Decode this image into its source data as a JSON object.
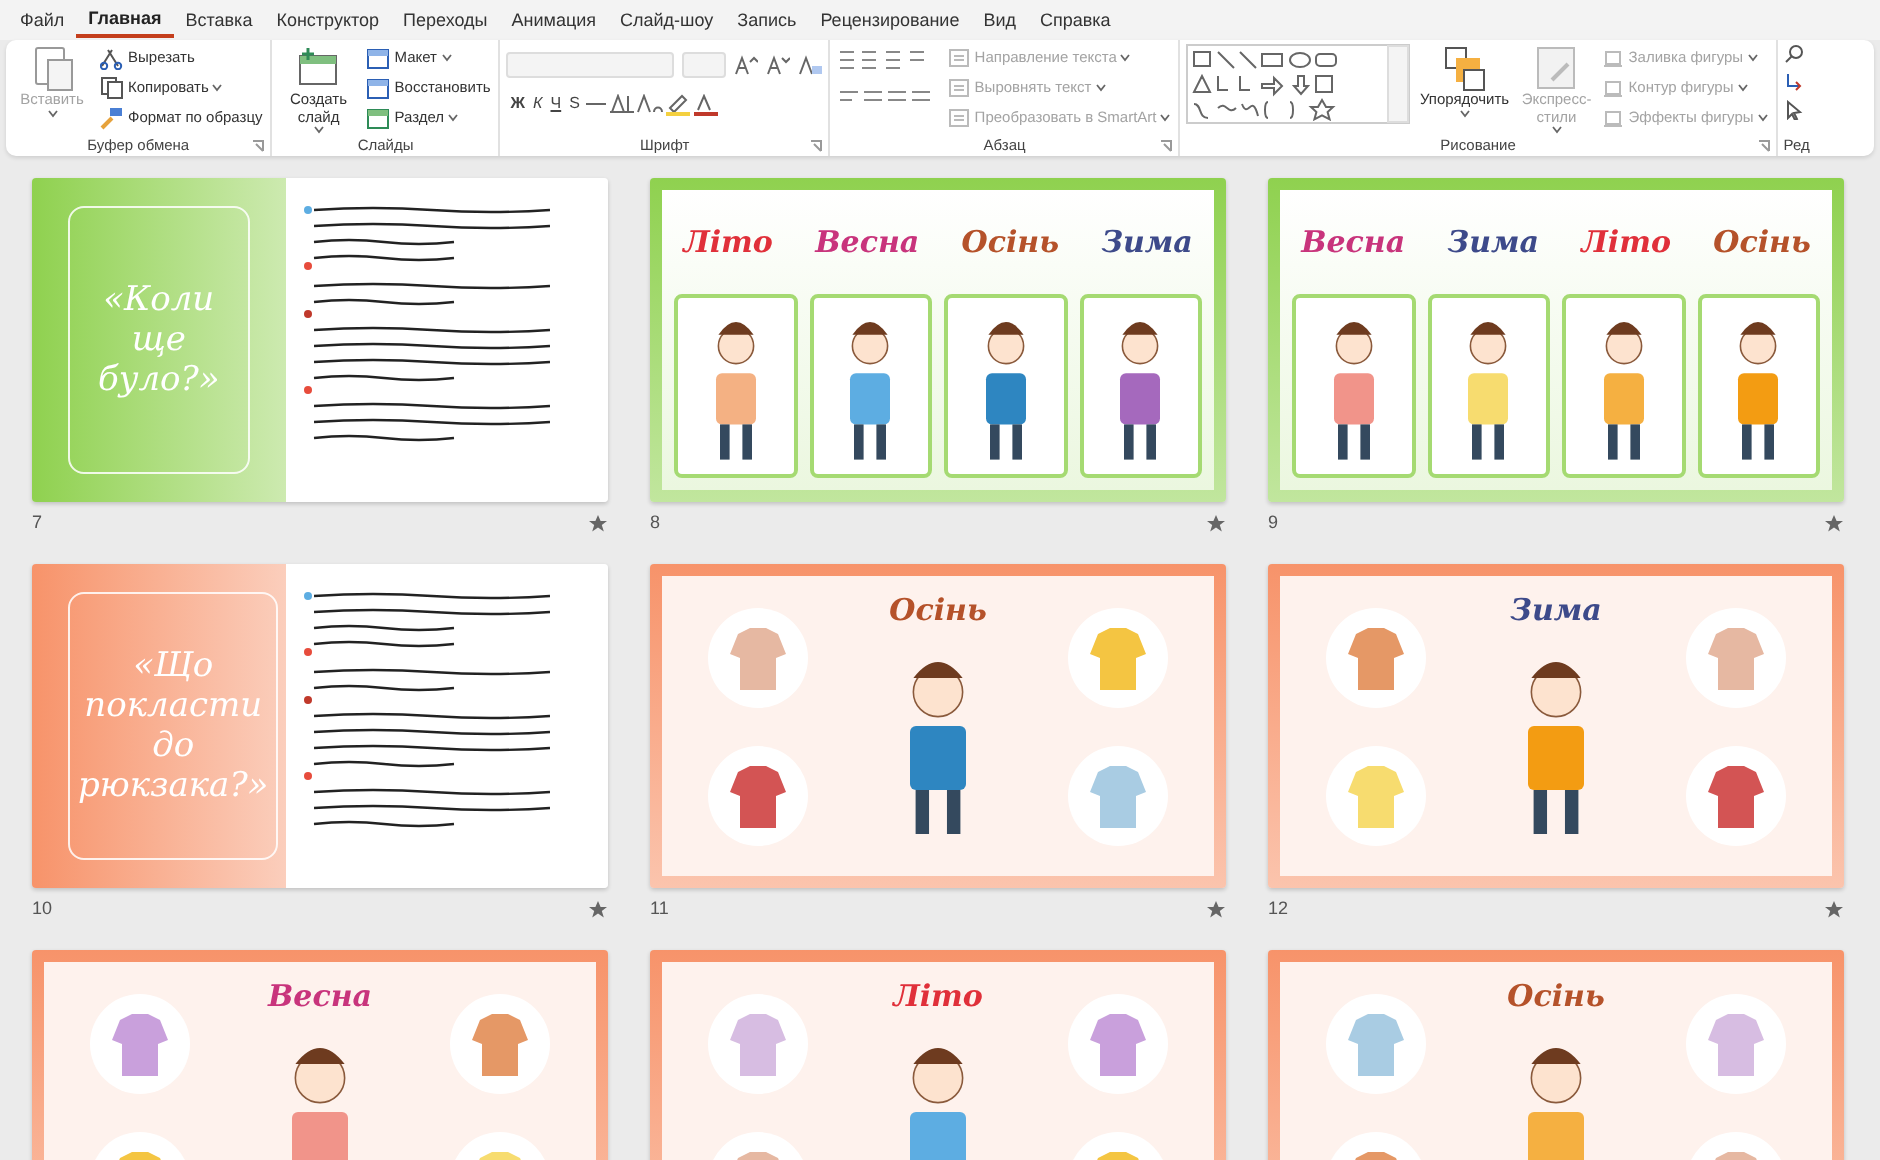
{
  "tabs": [
    {
      "label": "Файл",
      "selected": false
    },
    {
      "label": "Главная",
      "selected": true
    },
    {
      "label": "Вставка",
      "selected": false
    },
    {
      "label": "Конструктор",
      "selected": false
    },
    {
      "label": "Переходы",
      "selected": false
    },
    {
      "label": "Анимация",
      "selected": false
    },
    {
      "label": "Слайд-шоу",
      "selected": false
    },
    {
      "label": "Запись",
      "selected": false
    },
    {
      "label": "Рецензирование",
      "selected": false
    },
    {
      "label": "Вид",
      "selected": false
    },
    {
      "label": "Справка",
      "selected": false
    }
  ],
  "ribbon": {
    "groups": [
      {
        "kind": "commands",
        "label": "Буфер обмена",
        "launcher": true,
        "controls": [
          {
            "kind": "large",
            "label": "Вставить",
            "disabled": true,
            "dropdown": true
          },
          {
            "kind": "small",
            "label": "Вырезать",
            "disabled": false,
            "dropdown": false
          },
          {
            "kind": "small",
            "label": "Копировать",
            "disabled": false,
            "dropdown": true
          },
          {
            "kind": "small",
            "label": "Формат по образцу",
            "disabled": false,
            "dropdown": false
          }
        ]
      },
      {
        "kind": "commands",
        "label": "Слайды",
        "launcher": false,
        "controls": [
          {
            "kind": "large",
            "label": "Создать слайд",
            "disabled": false,
            "dropdown": true
          },
          {
            "kind": "small",
            "label": "Макет",
            "disabled": false,
            "dropdown": true
          },
          {
            "kind": "small",
            "label": "Восстановить",
            "disabled": false,
            "dropdown": false
          },
          {
            "kind": "small",
            "label": "Раздел",
            "disabled": false,
            "dropdown": true
          }
        ]
      },
      {
        "kind": "font",
        "label": "Шрифт",
        "launcher": true,
        "letters": [
          "Ж",
          "К",
          "Ч",
          "S"
        ]
      },
      {
        "kind": "paragraph",
        "label": "Абзац",
        "launcher": true,
        "controls": [
          {
            "kind": "small",
            "label": "Направление текста",
            "disabled": true,
            "dropdown": true
          },
          {
            "kind": "small",
            "label": "Выровнять текст",
            "disabled": true,
            "dropdown": true
          },
          {
            "kind": "small",
            "label": "Преобразовать в SmartArt",
            "disabled": true,
            "dropdown": true
          }
        ]
      },
      {
        "kind": "drawing",
        "label": "Рисование",
        "launcher": true,
        "controls": [
          {
            "kind": "large",
            "label": "Упорядочить",
            "disabled": false,
            "dropdown": true
          },
          {
            "kind": "large",
            "label": "Экспресс-стили",
            "disabled": true,
            "dropdown": true
          },
          {
            "kind": "small",
            "label": "Заливка фигуры",
            "disabled": true,
            "dropdown": true
          },
          {
            "kind": "small",
            "label": "Контур фигуры",
            "disabled": true,
            "dropdown": true
          },
          {
            "kind": "small",
            "label": "Эффекты фигуры",
            "disabled": true,
            "dropdown": true
          }
        ]
      },
      {
        "kind": "editing",
        "label": "Ред",
        "launcher": false
      }
    ]
  },
  "slides": [
    {
      "number": "7",
      "kind": "intro",
      "color": "#8fd14f",
      "transition": true,
      "title": "«Коли ще було?»"
    },
    {
      "number": "8",
      "kind": "seasons",
      "color": "#8fd14f",
      "transition": true,
      "seasons": [
        {
          "label": "Літо",
          "color": "#e0303a"
        },
        {
          "label": "Весна",
          "color": "#c8347c"
        },
        {
          "label": "Осінь",
          "color": "#b5522a"
        },
        {
          "label": "Зима",
          "color": "#3d4a8a"
        }
      ]
    },
    {
      "number": "9",
      "kind": "seasons",
      "color": "#8fd14f",
      "transition": true,
      "seasons": [
        {
          "label": "Весна",
          "color": "#c8347c"
        },
        {
          "label": "Зима",
          "color": "#3d4a8a"
        },
        {
          "label": "Літо",
          "color": "#e0303a"
        },
        {
          "label": "Осінь",
          "color": "#b5522a"
        }
      ]
    },
    {
      "number": "10",
      "kind": "intro",
      "color": "#f7936a",
      "transition": true,
      "title": "«Що покласти до рюкзака?»"
    },
    {
      "number": "11",
      "kind": "clothes",
      "color": "#f7936a",
      "transition": true,
      "title": {
        "label": "Осінь",
        "color": "#b5522a"
      }
    },
    {
      "number": "12",
      "kind": "clothes",
      "color": "#f7936a",
      "transition": true,
      "title": {
        "label": "Зима",
        "color": "#3d4a8a"
      }
    },
    {
      "kind": "clothes",
      "color": "#f7936a",
      "title": {
        "label": "Весна",
        "color": "#c8347c"
      }
    },
    {
      "kind": "clothes",
      "color": "#f7936a",
      "title": {
        "label": "Літо",
        "color": "#e0303a"
      }
    },
    {
      "kind": "clothes",
      "color": "#f7936a",
      "title": {
        "label": "Осінь",
        "color": "#b5522a"
      }
    }
  ]
}
